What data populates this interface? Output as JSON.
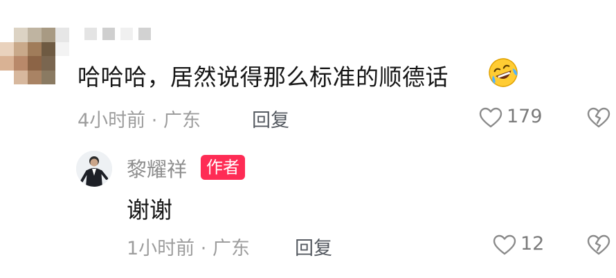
{
  "comment": {
    "text": "哈哈哈，居然说得那么标准的顺德话",
    "emoji_icon": "rolling-on-floor-laughing-emoji",
    "time": "4小时前",
    "location": "广东",
    "separator": "·",
    "reply_label": "回复",
    "like_count": "179"
  },
  "reply": {
    "author": "黎耀祥",
    "author_badge": "作者",
    "text": "谢谢",
    "time": "1小时前",
    "location": "广东",
    "separator": "·",
    "reply_label": "回复",
    "like_count": "12"
  },
  "colors": {
    "badge": "#fe2c55",
    "meta_text": "#9d9d9d",
    "body_text": "#161616"
  }
}
